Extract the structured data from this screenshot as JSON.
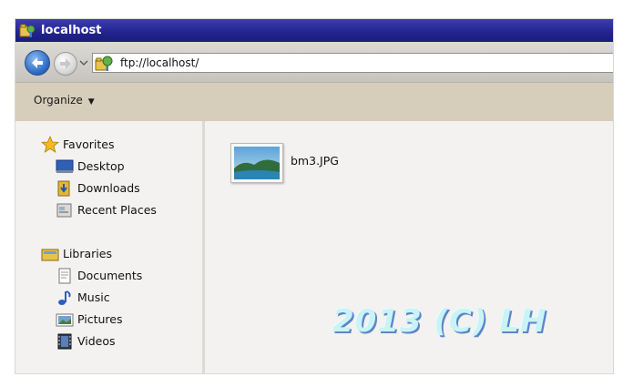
{
  "window": {
    "title": "localhost"
  },
  "address": {
    "value": "ftp://localhost/"
  },
  "toolbar": {
    "organize_label": "Organize"
  },
  "nav": {
    "favorites": {
      "label": "Favorites",
      "items": [
        {
          "label": "Desktop",
          "icon": "desktop-icon"
        },
        {
          "label": "Downloads",
          "icon": "downloads-icon"
        },
        {
          "label": "Recent Places",
          "icon": "recent-places-icon"
        }
      ]
    },
    "libraries": {
      "label": "Libraries",
      "items": [
        {
          "label": "Documents",
          "icon": "documents-icon"
        },
        {
          "label": "Music",
          "icon": "music-icon"
        },
        {
          "label": "Pictures",
          "icon": "pictures-icon"
        },
        {
          "label": "Videos",
          "icon": "videos-icon"
        }
      ]
    }
  },
  "files": [
    {
      "name": "bm3.JPG",
      "icon": "image-thumbnail"
    }
  ],
  "watermark": {
    "text": "2013 (C) LH"
  },
  "colors": {
    "titlebar": "#22228e",
    "toolbar": "#d6cdbb",
    "pane_background": "#f3f2f0",
    "watermark": "#c9f3f6"
  }
}
